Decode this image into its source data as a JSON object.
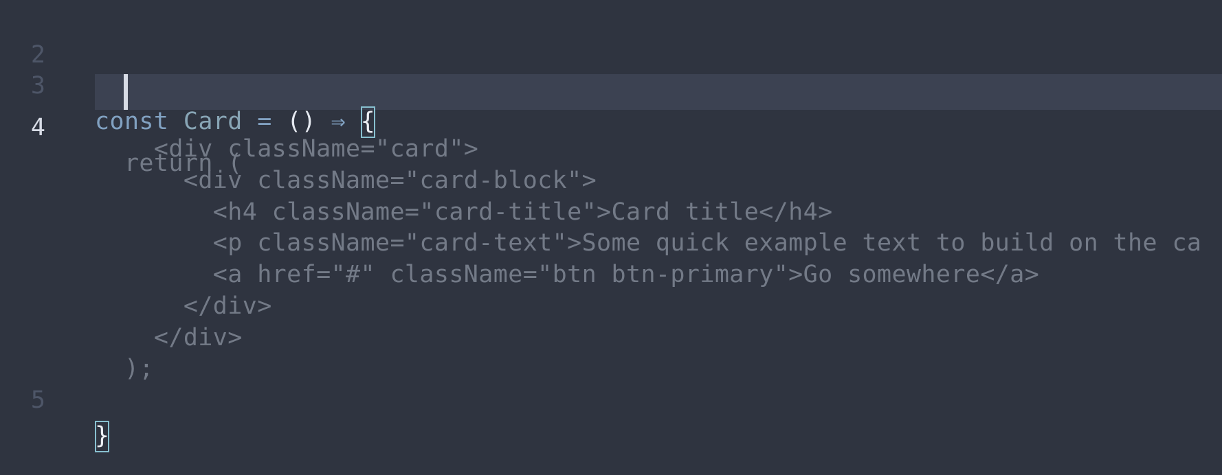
{
  "editor": {
    "active_line": "4",
    "lines": [
      {
        "number": "2",
        "indent": "",
        "text": ""
      },
      {
        "number": "3",
        "tokens": {
          "keyword": "const",
          "name": "Card",
          "equals": "=",
          "parens": "()",
          "arrow": "⇒",
          "open_brace": "{"
        }
      },
      {
        "number": "4",
        "indent": "  ",
        "text": "return ("
      },
      {
        "number": "",
        "indent": "    ",
        "text": "<div className=\"card\">"
      },
      {
        "number": "",
        "indent": "      ",
        "text": "<div className=\"card-block\">"
      },
      {
        "number": "",
        "indent": "        ",
        "text": "<h4 className=\"card-title\">Card title</h4>"
      },
      {
        "number": "",
        "indent": "        ",
        "text": "<p className=\"card-text\">Some quick example text to build on the ca"
      },
      {
        "number": "",
        "indent": "        ",
        "text": "<a href=\"#\" className=\"btn btn-primary\">Go somewhere</a>"
      },
      {
        "number": "",
        "indent": "      ",
        "text": "</div>"
      },
      {
        "number": "",
        "indent": "    ",
        "text": "</div>"
      },
      {
        "number": "",
        "indent": "  ",
        "text": ");"
      },
      {
        "number": "5",
        "close_brace": "}"
      }
    ]
  },
  "colors": {
    "background": "#2f3440",
    "active_line_background": "#3c4252",
    "keyword": "#81a1c1",
    "identifier": "#88a5b5",
    "dimmed_code": "#737a87",
    "bracket_match_outline": "#88c0d0",
    "cursor": "#d8dce6"
  }
}
